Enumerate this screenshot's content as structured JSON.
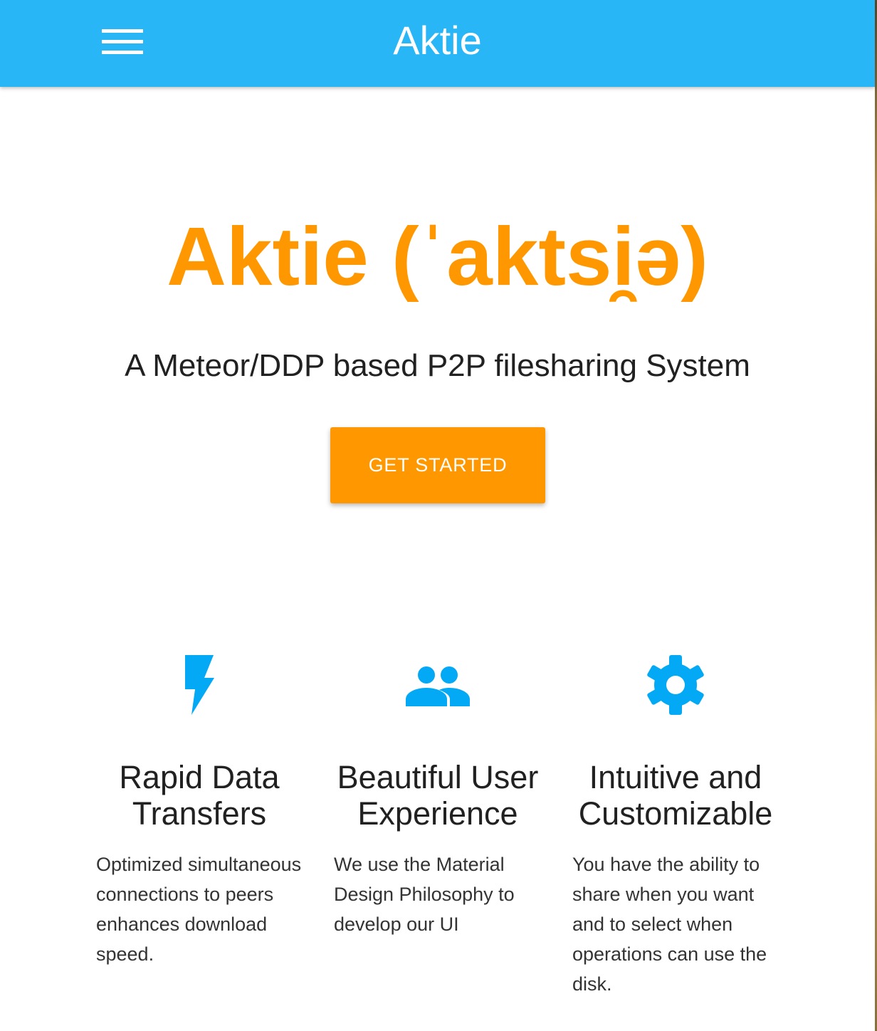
{
  "appbar": {
    "title": "Aktie",
    "color": "#29b6f6"
  },
  "hero": {
    "title": "Aktie (ˈaktsi̯ə)",
    "subtitle": "A Meteor/DDP based P2P filesharing System",
    "cta_label": "GET STARTED",
    "accent": "#ff9800"
  },
  "features": [
    {
      "icon": "flash-icon",
      "title_line1": "Rapid Data",
      "title_line2": "Transfers",
      "text": "Optimized simultaneous connections to peers enhances download speed."
    },
    {
      "icon": "people-icon",
      "title_line1": "Beautiful User",
      "title_line2": "Experience",
      "text": "We use the Material Design Philosophy to develop our UI"
    },
    {
      "icon": "gear-icon",
      "title_line1": "Intuitive and",
      "title_line2": "Customizable",
      "text": "You have the ability to share when you want and to select when operations can use the disk."
    }
  ]
}
